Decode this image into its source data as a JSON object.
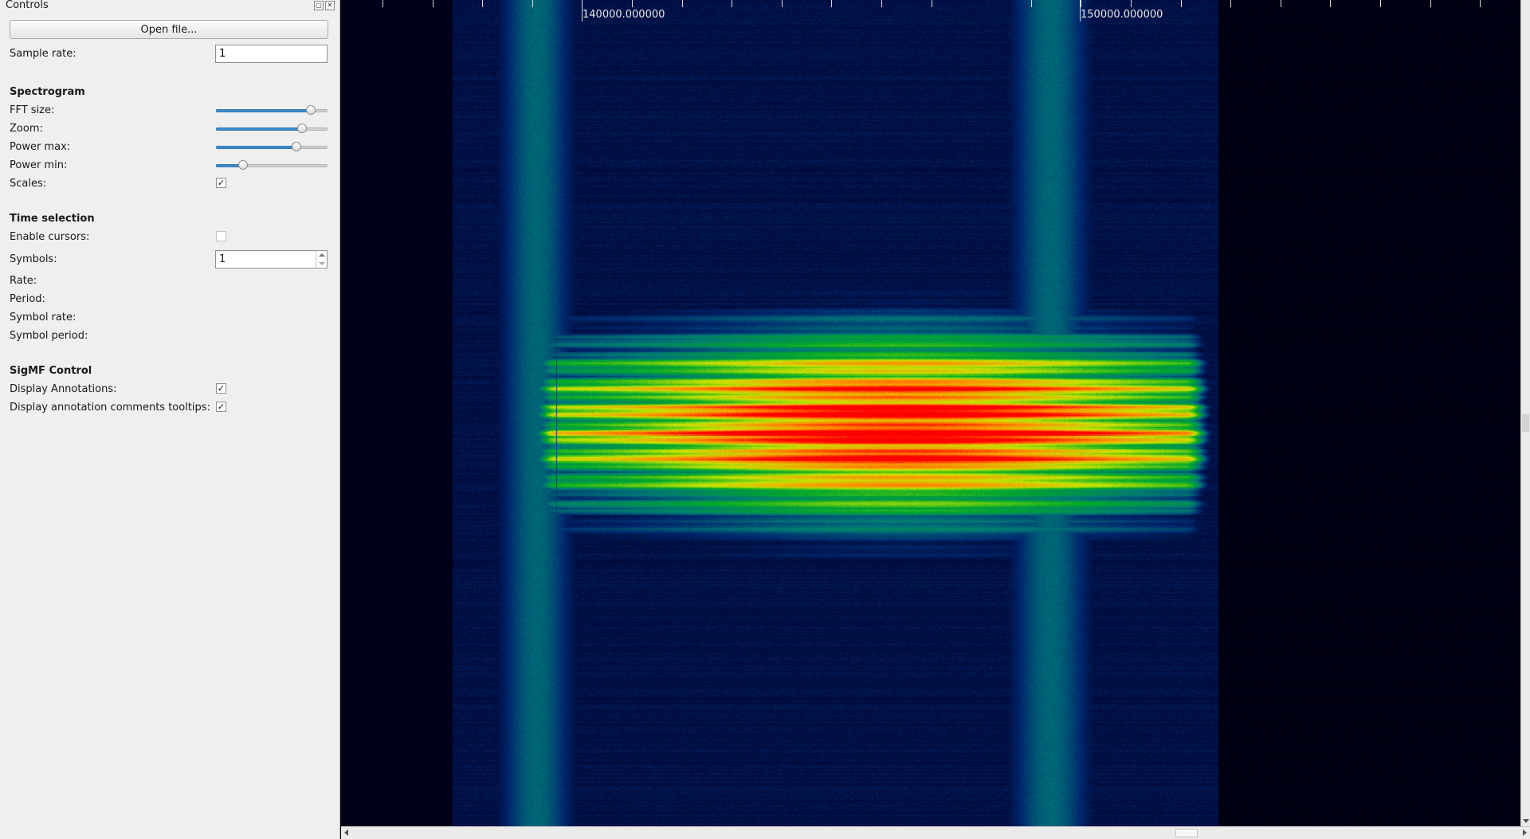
{
  "dock": {
    "title": "Controls",
    "float_icon": "float-icon",
    "close_icon": "close-icon",
    "open_file_label": "Open file...",
    "sample_rate": {
      "label": "Sample rate:",
      "value": "1"
    },
    "spectrogram": {
      "heading": "Spectrogram",
      "fft_size": {
        "label": "FFT size:",
        "level": 0.85
      },
      "zoom": {
        "label": "Zoom:",
        "level": 0.77
      },
      "power_max": {
        "label": "Power max:",
        "level": 0.72
      },
      "power_min": {
        "label": "Power min:",
        "level": 0.24
      },
      "scales": {
        "label": "Scales:",
        "checked": true
      }
    },
    "time_selection": {
      "heading": "Time selection",
      "enable_cursors": {
        "label": "Enable cursors:",
        "checked": false
      },
      "symbols": {
        "label": "Symbols:",
        "value": "1"
      },
      "rate": {
        "label": "Rate:"
      },
      "period": {
        "label": "Period:"
      },
      "symbol_rate": {
        "label": "Symbol rate:"
      },
      "symbol_period": {
        "label": "Symbol period:"
      }
    },
    "sigmf": {
      "heading": "SigMF Control",
      "display_annotations": {
        "label": "Display Annotations:",
        "checked": true
      },
      "display_tooltips": {
        "label": "Display annotation comments tooltips:",
        "checked": true
      }
    },
    "check_glyph": "✓"
  },
  "ruler": {
    "labels": [
      "140000.000000",
      "150000.000000"
    ]
  },
  "colors": {
    "panel_bg": "#efefef",
    "slider_fill": "#3d8fd1",
    "spectrogram_bg": "#000000"
  }
}
